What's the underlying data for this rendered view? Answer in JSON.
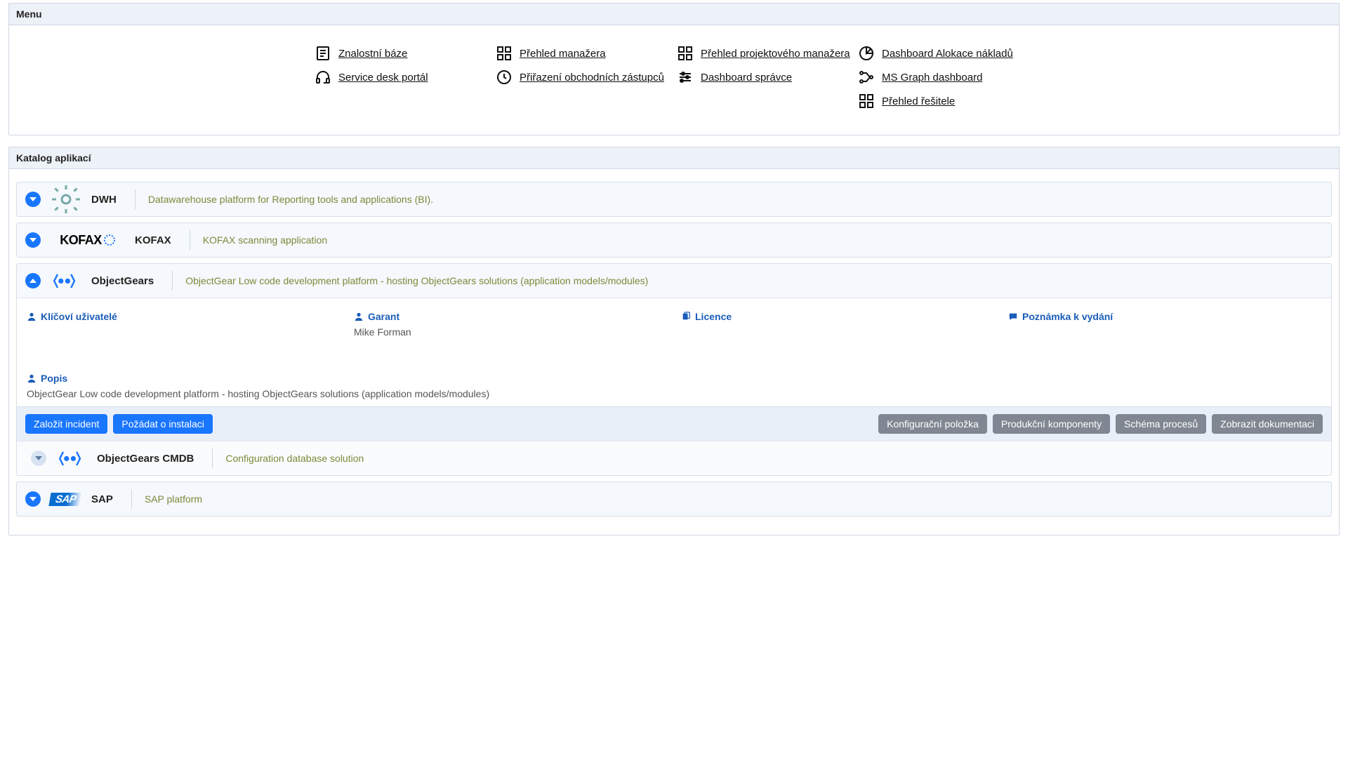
{
  "menu": {
    "title": "Menu",
    "cols": [
      [
        {
          "icon": "doc",
          "label": "Znalostní báze"
        },
        {
          "icon": "headset",
          "label": "Service desk portál"
        }
      ],
      [
        {
          "icon": "grid",
          "label": "Přehled manažera"
        },
        {
          "icon": "clock",
          "label": "Přiřazení obchodních zástupců"
        }
      ],
      [
        {
          "icon": "grid",
          "label": "Přehled projektového manažera"
        },
        {
          "icon": "sliders",
          "label": "Dashboard správce"
        }
      ],
      [
        {
          "icon": "pie",
          "label": "Dashboard Alokace nákladů"
        },
        {
          "icon": "graph",
          "label": "MS Graph dashboard"
        },
        {
          "icon": "grid",
          "label": "Přehled řešitele"
        }
      ]
    ]
  },
  "catalog": {
    "title": "Katalog aplikací",
    "apps": [
      {
        "name": "DWH",
        "desc": "Datawarehouse platform for Reporting tools and applications (BI).",
        "logo": "gear"
      },
      {
        "name": "KOFAX",
        "desc": "KOFAX scanning application",
        "logo": "kofax"
      },
      {
        "name": "ObjectGears",
        "desc": "ObjectGear Low code development platform - hosting ObjectGears solutions (application models/modules)",
        "logo": "og",
        "expanded": true,
        "detail": {
          "key_users_label": "Klíčoví uživatelé",
          "guarantor_label": "Garant",
          "guarantor_value": "Mike Forman",
          "licence_label": "Licence",
          "release_note_label": "Poznámka k vydání",
          "popis_label": "Popis",
          "popis_value": "ObjectGear Low code development platform - hosting ObjectGears solutions (application models/modules)"
        },
        "actions_primary": [
          "Založit incident",
          "Požádat o instalaci"
        ],
        "actions_grey": [
          "Konfigurační položka",
          "Produkční komponenty",
          "Schéma procesů",
          "Zobrazit dokumentaci"
        ],
        "sub": {
          "name": "ObjectGears CMDB",
          "desc": "Configuration database solution",
          "logo": "og"
        }
      },
      {
        "name": "SAP",
        "desc": "SAP platform",
        "logo": "sap"
      }
    ]
  }
}
